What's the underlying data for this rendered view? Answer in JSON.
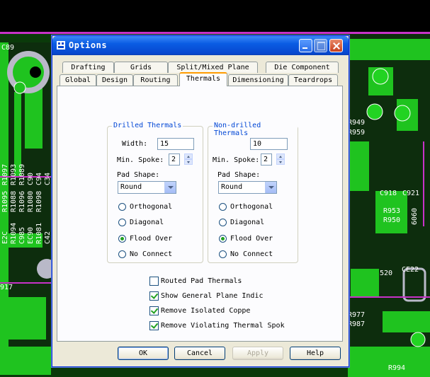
{
  "background": {
    "labels": [
      "C89",
      "R949",
      "R959",
      "C918",
      "C921",
      "R953",
      "R950",
      "6060",
      "CE22",
      "520",
      "R977",
      "R987",
      "917",
      "R1095",
      "R1088",
      "R1096",
      "R1080",
      "C985",
      "E2C",
      "R1081",
      "R1097",
      "R1093",
      "R1094",
      "R1089",
      "C90",
      "C94",
      "C34",
      "EC90",
      "C42",
      "R1098",
      "R994"
    ],
    "colors": {
      "board": "#000000",
      "copper": "#1fc31f",
      "trace": "#22d322",
      "silk": "#ffffff",
      "outline": "#c832c8",
      "pad": "#b9b9c8"
    }
  },
  "dialog": {
    "title": "Options",
    "title_icon": "options-app-icon",
    "tabs_back": [
      "Drafting",
      "Grids",
      "Split/Mixed Plane",
      "Die Component"
    ],
    "tabs_front": [
      "Global",
      "Design",
      "Routing",
      "Thermals",
      "Dimensioning",
      "Teardrops"
    ],
    "active_tab": "Thermals",
    "drilled": {
      "title": "Drilled Thermals",
      "width_label": "Width:",
      "width_value": "15",
      "min_spoke_label": "Min. Spoke:",
      "min_spoke_value": "2",
      "pad_shape_label": "Pad Shape:",
      "pad_shape_value": "Round",
      "radios": [
        "Orthogonal",
        "Diagonal",
        "Flood Over",
        "No Connect"
      ],
      "selected": "Flood Over"
    },
    "nondrilled": {
      "title": "Non-drilled Thermals",
      "width_value": "10",
      "min_spoke_label": "Min. Spoke:",
      "min_spoke_value": "2",
      "pad_shape_label": "Pad Shape:",
      "pad_shape_value": "Round",
      "radios": [
        "Orthogonal",
        "Diagonal",
        "Flood Over",
        "No Connect"
      ],
      "selected": "Flood Over"
    },
    "checks": [
      {
        "label": "Routed Pad Thermals",
        "checked": false
      },
      {
        "label": "Show General Plane Indic",
        "checked": true
      },
      {
        "label": "Remove Isolated Coppe",
        "checked": true
      },
      {
        "label": "Remove Violating Thermal Spok",
        "checked": true
      }
    ],
    "buttons": {
      "ok": "OK",
      "cancel": "Cancel",
      "apply": "Apply",
      "help": "Help"
    }
  }
}
